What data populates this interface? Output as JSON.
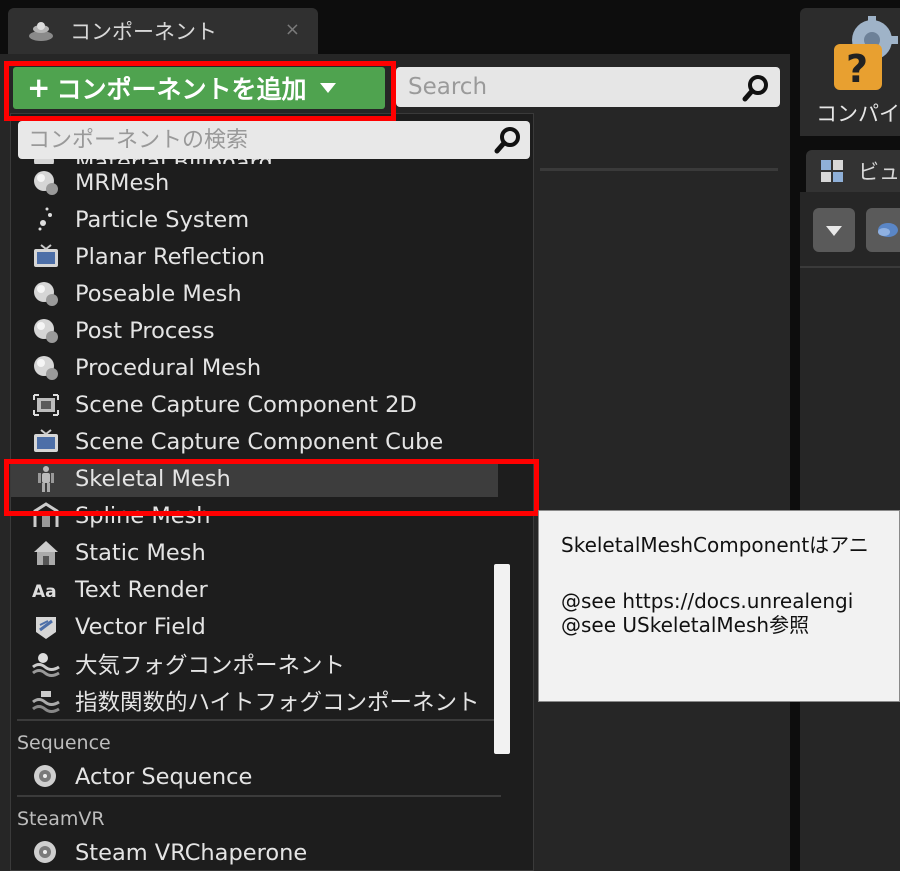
{
  "tab": {
    "title": "コンポーネント",
    "close": "×"
  },
  "toolbar": {
    "add_button_plus": "+",
    "add_button_label": "コンポーネントを追加",
    "search_placeholder": "Search"
  },
  "dropdown": {
    "search_placeholder": "コンポーネントの検索",
    "cut_item": "Material Billboard",
    "items": [
      {
        "label": "MRMesh",
        "icon": "sphere-icon"
      },
      {
        "label": "Particle System",
        "icon": "particle-icon"
      },
      {
        "label": "Planar Reflection",
        "icon": "tv-icon"
      },
      {
        "label": "Poseable Mesh",
        "icon": "sphere-icon"
      },
      {
        "label": "Post Process",
        "icon": "sphere-icon"
      },
      {
        "label": "Procedural Mesh",
        "icon": "sphere-icon"
      },
      {
        "label": "Scene Capture Component 2D",
        "icon": "capture-icon"
      },
      {
        "label": "Scene Capture Component Cube",
        "icon": "tv-icon"
      },
      {
        "label": "Skeletal Mesh",
        "icon": "skeletal-figure-icon"
      },
      {
        "label": "Spline Mesh",
        "icon": "spline-icon"
      },
      {
        "label": "Static Mesh",
        "icon": "house-icon"
      },
      {
        "label": "Text Render",
        "icon": "text-aa-icon"
      },
      {
        "label": "Vector Field",
        "icon": "vector-field-icon"
      },
      {
        "label": "大気フォグコンポーネント",
        "icon": "fog-icon"
      },
      {
        "label": "指数関数的ハイトフォグコンポーネント",
        "icon": "height-fog-icon"
      }
    ],
    "sections": [
      {
        "title": "Sequence",
        "items": [
          {
            "label": "Actor Sequence",
            "icon": "sequence-icon"
          }
        ]
      },
      {
        "title": "SteamVR",
        "items": [
          {
            "label": "Steam VRChaperone",
            "icon": "sequence-icon"
          }
        ]
      }
    ]
  },
  "tooltip": {
    "line1": "SkeletalMeshComponentはアニ",
    "line2": "@see https://docs.unrealengi",
    "line3": "@see USkeletalMesh参照"
  },
  "right": {
    "compile_label": "コンパイ",
    "viewport_tab": "ビュ"
  },
  "colors": {
    "accent_green": "#4fa34f",
    "highlight_red": "#ff0000",
    "panel_bg": "#262626",
    "tooltip_bg": "#f2f2f2"
  }
}
